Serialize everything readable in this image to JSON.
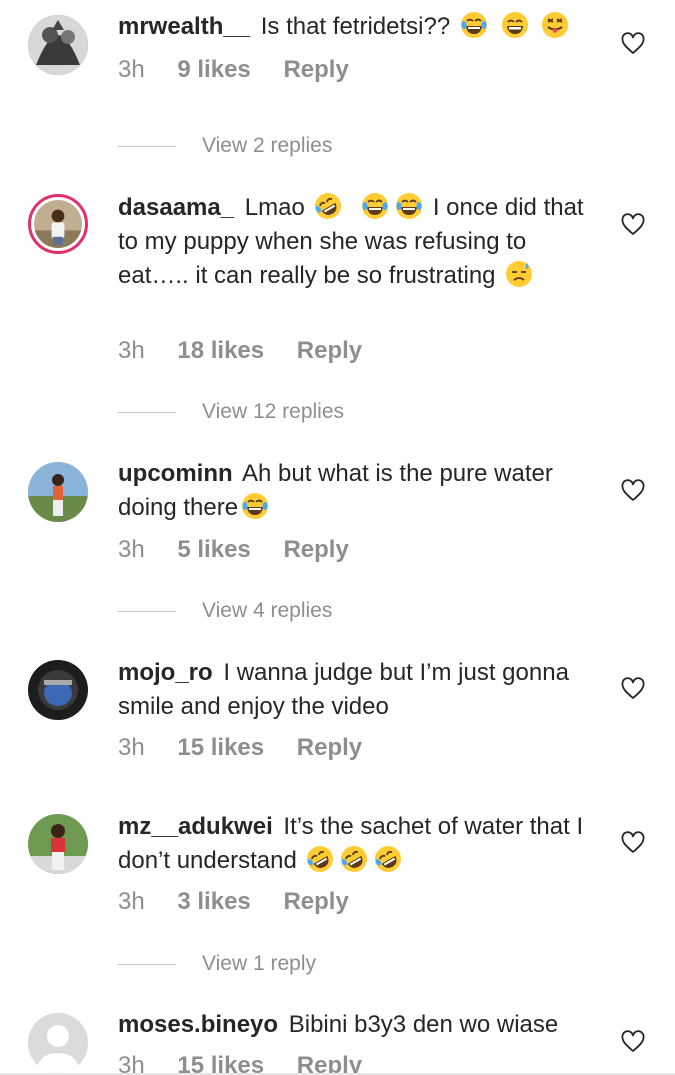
{
  "comments": [
    {
      "username": "mrwealth__",
      "text": "Is that fetridetsi??",
      "emojis": [
        "laughing-tears",
        "grin",
        "tongue"
      ],
      "time": "3h",
      "likes": "9 likes",
      "reply": "Reply",
      "view_replies": "View 2 replies"
    },
    {
      "username": "dasaama_",
      "text": "Lmao",
      "text2": "I once did that to my puppy when she was refusing to eat….. it can really be so frustrating",
      "emojis": [
        "rofl",
        "laughing-tears",
        "laughing-tears"
      ],
      "time": "3h",
      "likes": "18 likes",
      "reply": "Reply",
      "view_replies": "View 12 replies"
    },
    {
      "username": "upcominn",
      "text": "Ah but what is the pure water doing there",
      "time": "3h",
      "likes": "5 likes",
      "reply": "Reply",
      "view_replies": "View 4 replies"
    },
    {
      "username": "mojo_ro",
      "text": "I wanna judge but I’m just gonna smile and enjoy the video",
      "time": "3h",
      "likes": "15 likes",
      "reply": "Reply"
    },
    {
      "username": "mz__adukwei",
      "text": "It’s the sachet of water that I don’t understand",
      "emojis": [
        "rofl",
        "rofl",
        "rofl"
      ],
      "time": "3h",
      "likes": "3 likes",
      "reply": "Reply",
      "view_replies": "View 1 reply"
    },
    {
      "username": "moses.bineyo",
      "text": "Bibini b3y3 den wo wiase",
      "time": "3h",
      "likes": "15 likes",
      "reply": "Reply"
    }
  ],
  "colors": {
    "text": "#262626",
    "meta": "#8e8e8e",
    "story_ring": "#e1306c",
    "emoji_yellow": "#ffcc33"
  },
  "icons": {
    "like": "heart-outline-icon",
    "default_avatar": "person-silhouette-icon"
  }
}
